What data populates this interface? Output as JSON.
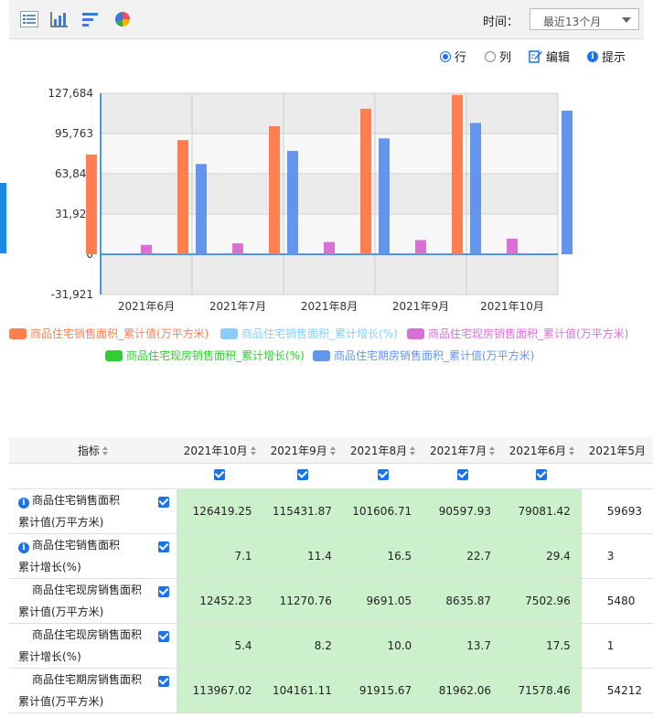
{
  "toolbar": {
    "icons": [
      "list-view-icon",
      "bar-chart-icon",
      "horizontal-bar-icon",
      "pie-chart-icon"
    ],
    "time_label": "时间：",
    "time_value": "最近13个月"
  },
  "options": {
    "row": "行",
    "col": "列",
    "edit": "编辑",
    "tip": "提示"
  },
  "colors": {
    "s1": "#ff7f50",
    "s2": "#87cefa",
    "s3": "#da70d6",
    "s4": "#32cd32",
    "s5": "#6495ed"
  },
  "chart_data": {
    "type": "bar",
    "categories": [
      "2021年6月",
      "2021年7月",
      "2021年8月",
      "2021年9月",
      "2021年10月"
    ],
    "y_ticks": [
      "127,684",
      "95,763",
      "63,842",
      "31,921",
      "0",
      "-31,921"
    ],
    "ylim": [
      -31921,
      127684
    ],
    "series": [
      {
        "name": "商品住宅销售面积_累计值(万平方米)",
        "values": [
          79081.42,
          90597.93,
          101606.71,
          115431.87,
          126419.25
        ]
      },
      {
        "name": "商品住宅销售面积_累计增长(%)",
        "values": [
          29.4,
          22.7,
          16.5,
          11.4,
          7.1
        ]
      },
      {
        "name": "商品住宅现房销售面积_累计值(万平方米)",
        "values": [
          7502.96,
          8635.87,
          9691.05,
          11270.76,
          12452.23
        ]
      },
      {
        "name": "商品住宅现房销售面积_累计增长(%)",
        "values": [
          17.5,
          13.7,
          10.0,
          8.2,
          5.4
        ]
      },
      {
        "name": "商品住宅期房销售面积_累计值(万平方米)",
        "values": [
          71578.46,
          81962.06,
          91915.67,
          104161.11,
          113967.02
        ]
      }
    ]
  },
  "table": {
    "header_label": "指标",
    "columns": [
      "2021年10月",
      "2021年9月",
      "2021年8月",
      "2021年7月",
      "2021年6月",
      "2021年5月"
    ],
    "rows": [
      {
        "line1": "商品住宅销售面积",
        "line2": "累计值(万平方米)",
        "info": true,
        "values": [
          "126419.25",
          "115431.87",
          "101606.71",
          "90597.93",
          "79081.42",
          "59693"
        ]
      },
      {
        "line1": "商品住宅销售面积",
        "line2": "累计增长(%)",
        "info": true,
        "values": [
          "7.1",
          "11.4",
          "16.5",
          "22.7",
          "29.4",
          "3"
        ]
      },
      {
        "line1": "商品住宅现房销售面积",
        "line2": "累计值(万平方米)",
        "info": false,
        "values": [
          "12452.23",
          "11270.76",
          "9691.05",
          "8635.87",
          "7502.96",
          "5480"
        ]
      },
      {
        "line1": "商品住宅现房销售面积",
        "line2": "累计增长(%)",
        "info": false,
        "values": [
          "5.4",
          "8.2",
          "10.0",
          "13.7",
          "17.5",
          "1"
        ]
      },
      {
        "line1": "商品住宅期房销售面积",
        "line2": "累计值(万平方米)",
        "info": false,
        "values": [
          "113967.02",
          "104161.11",
          "91915.67",
          "81962.06",
          "71578.46",
          "54212"
        ]
      }
    ]
  }
}
